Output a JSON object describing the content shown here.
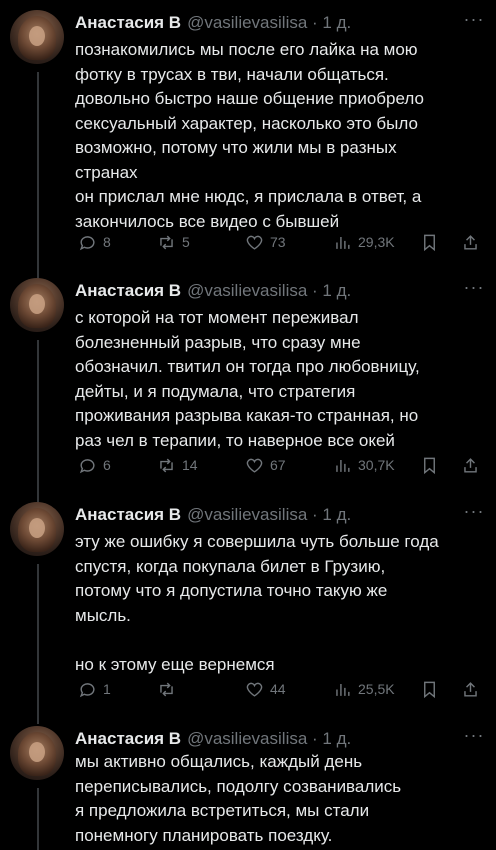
{
  "tweets": [
    {
      "name": "Анастасия В",
      "handle": "@vasilievasilisa · 1 д.",
      "text": "познакомились мы после его лайка на мою\nфотку в трусах в тви, начали общаться.\nдовольно быстро наше общение приобрело\nсексуальный характер, насколько это было\nвозможно, потому что жили мы в разных\nстранах\nон прислал мне нюдс, я прислала в ответ, а\nзакончилось все видео с бывшей",
      "replies": "8",
      "reposts": "5",
      "likes": "73",
      "views": "29,3K"
    },
    {
      "name": "Анастасия В",
      "handle": "@vasilievasilisa · 1 д.",
      "text": "с которой на тот момент переживал\nболезненный разрыв, что сразу мне\nобозначил. твитил он тогда про любовницу,\nдейты, и я подумала, что стратегия\nпроживания разрыва какая-то странная, но\nраз чел в терапии, то наверное все окей",
      "replies": "6",
      "reposts": "14",
      "likes": "67",
      "views": "30,7K"
    },
    {
      "name": "Анастасия В",
      "handle": "@vasilievasilisa · 1 д.",
      "text": "эту же ошибку я совершила чуть больше года\nспустя, когда покупала билет в Грузию,\nпотому что я допустила точно такую же\nмысль.\n\nно к этому еще вернемся",
      "replies": "1",
      "reposts": "",
      "likes": "44",
      "views": "25,5K"
    },
    {
      "name": "Анастасия В",
      "handle": "@vasilievasilisa · 1 д.",
      "text": "мы активно общались, каждый день\nпереписывались, подолгу созванивались\nя предложила встретиться, мы стали\nпонемногу планировать поездку.",
      "replies": "",
      "reposts": "",
      "likes": "",
      "views": ""
    }
  ]
}
